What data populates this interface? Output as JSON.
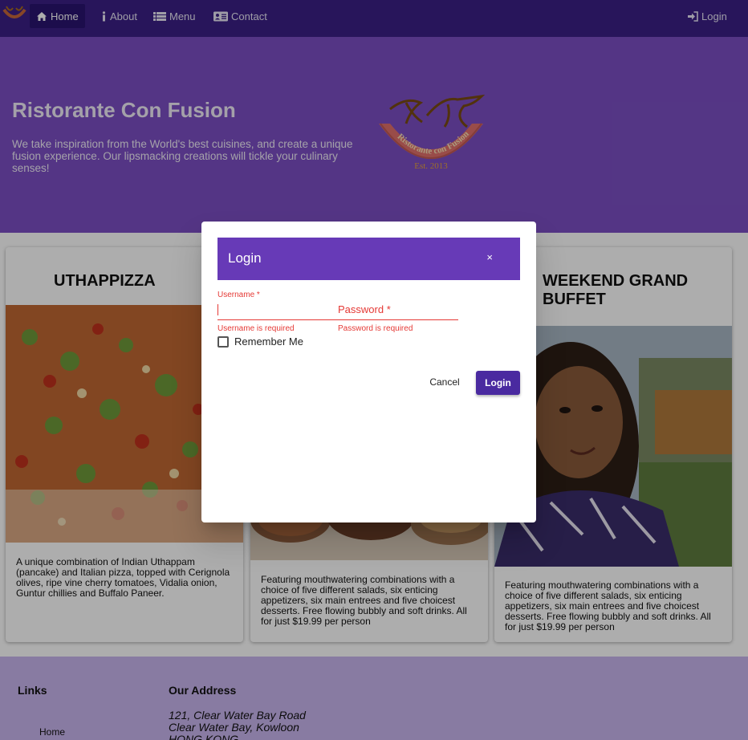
{
  "nav": {
    "items": [
      {
        "label": "Home",
        "icon": "home-icon"
      },
      {
        "label": "About",
        "icon": "info-icon"
      },
      {
        "label": "Menu",
        "icon": "list-icon"
      },
      {
        "label": "Contact",
        "icon": "address-card-icon"
      }
    ],
    "login_label": "Login"
  },
  "jumbotron": {
    "title": "Ristorante Con Fusion",
    "text": "We take inspiration from the World's best cuisines, and create a unique fusion experience. Our lipsmacking creations will tickle your culinary senses!",
    "logo_text": "Ristorante con Fusion",
    "logo_est": "Est. 2013"
  },
  "cards": [
    {
      "title": "UTHAPPIZZA",
      "text": "A unique combination of Indian Uthappam (pancake) and Italian pizza, topped with Cerignola olives, ripe vine cherry tomatoes, Vidalia onion, Guntur chillies and Buffalo Paneer."
    },
    {
      "title": "",
      "text": "Featuring mouthwatering combinations with a choice of five different salads, six enticing appetizers, six main entrees and five choicest desserts. Free flowing bubbly and soft drinks. All for just $19.99 per person"
    },
    {
      "title": "WEEKEND GRAND BUFFET",
      "text": "Featuring mouthwatering combinations with a choice of five different salads, six enticing appetizers, six main entrees and five choicest desserts. Free flowing bubbly and soft drinks. All for just $19.99 per person"
    }
  ],
  "footer": {
    "links_heading": "Links",
    "links": [
      "Home"
    ],
    "address_heading": "Our Address",
    "address_lines": [
      "121, Clear Water Bay Road",
      "Clear Water Bay, Kowloon",
      "HONG KONG"
    ]
  },
  "dialog": {
    "title": "Login",
    "close": "×",
    "username_label": "Username *",
    "password_label": "Password *",
    "username_error": "Username is required",
    "password_error": "Password is required",
    "remember_label": "Remember Me",
    "cancel_label": "Cancel",
    "login_label": "Login"
  },
  "colors": {
    "navbar": "#3b1f86",
    "jumbotron": "#7c4fc4",
    "dialog_header": "#673ab7",
    "error": "#e53935",
    "primary_button": "#4a2aa0"
  }
}
